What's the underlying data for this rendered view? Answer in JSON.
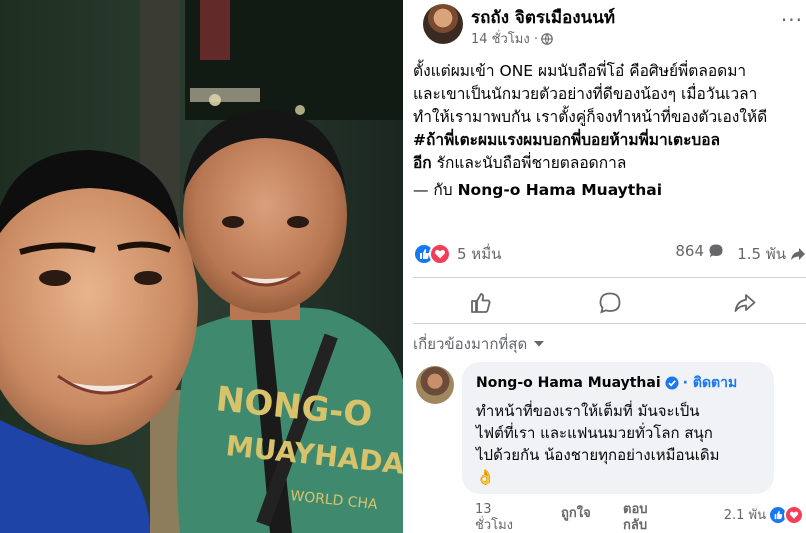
{
  "post": {
    "author": "รถถัง จิตรเมืองนนท์",
    "time": "14 ชั่วโมง ·",
    "more_label": "···",
    "text_line1": "ตั้งแต่ผมเข้า ONE ผมนับถือพี่โอ๋ คือศิษย์พี่ตลอดมา",
    "text_line2": "และเขาเป็นนักมวยตัวอย่างที่ดีของน้องๆ เมื่อวันเวลา",
    "text_line3": "ทำให้เรามาพบกัน เราตั้งคู่ก็จงทำหน้าที่ของตัวเองให้ดี",
    "hashtag_line1": "#ถ้าพี่เตะผมแรงผมบอกพี่บอยห้ามพี่มาเตะบอล",
    "hashtag_line2": "อีก",
    "text_tail": " รักและนับถือพี่ชายตลอดกาล",
    "with_prefix": "— กับ ",
    "with_name": "Nong-o Hama Muaythai",
    "reactions": "5 หมื่น",
    "comments": "864",
    "shares": "1.5 พัน"
  },
  "relevance_label": "เกี่ยวข้องมากที่สุด",
  "comment": {
    "name": "Nong-o Hama Muaythai",
    "follow": "· ติดตาม",
    "line1": "ทำหน้าที่ของเราให้เต็มที่ มันจะเป็น",
    "line2": "ไฟต์ที่เรา และแฟนนมวยทั่วโลก สนุก",
    "line3": "ไปด้วยกัน น้องชายทุกอย่างเหมือนเดิม",
    "emoji": "👌",
    "time": "13 ชั่วโมง",
    "like_label": "ถูกใจ",
    "reply_label": "ตอบกลับ",
    "reactions": "2.1 พัน"
  },
  "shirt_text": {
    "line1": "NONG-O",
    "line2": "MUAYHADA",
    "line3": "WORLD CHA"
  },
  "colors": {
    "facebook_blue": "#1877f2",
    "love_red": "#f33e58",
    "muted": "#65676b",
    "shirt_green": "#3f8a6e",
    "shirt_text": "#d9c36a"
  }
}
